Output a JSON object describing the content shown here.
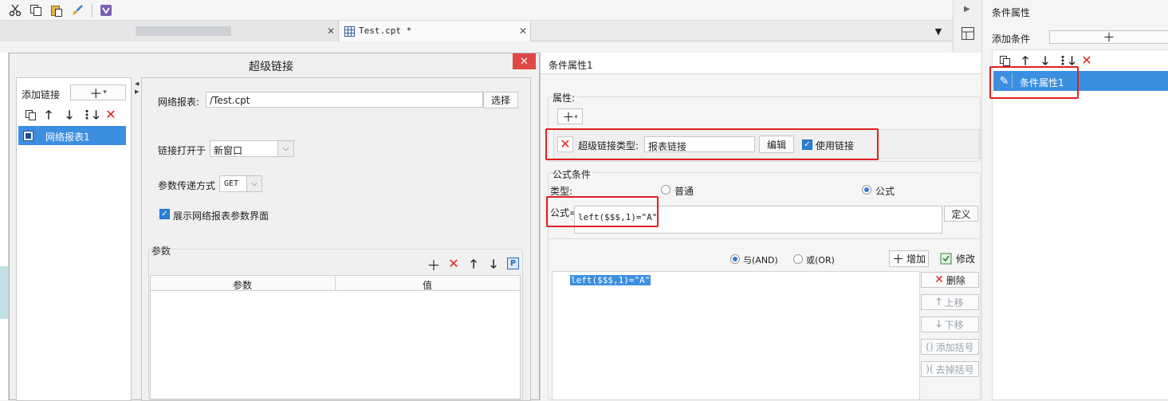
{
  "editor": {
    "tab_title": "Test.cpt *"
  },
  "hyperlink_dialog": {
    "title": "超级链接",
    "add_link_label": "添加链接",
    "link_item": "网络报表1",
    "network_report_label": "网络报表:",
    "network_report_value": "/Test.cpt",
    "select_button": "选择",
    "open_in_label": "链接打开于",
    "open_in_value": "新窗口",
    "param_method_label": "参数传递方式",
    "param_method_value": "GET",
    "show_params_label": "展示网络报表参数界面",
    "params_section": "参数",
    "params_columns": [
      "参数",
      "值"
    ]
  },
  "condition_panel": {
    "title": "条件属性1",
    "attributes_section": "属性:",
    "hyperlink_type_label": "超级链接类型:",
    "hyperlink_type_value": "报表链接",
    "edit_button": "编辑",
    "use_link_label": "使用链接",
    "formula_section": "公式条件",
    "type_label": "类型:",
    "radio_normal": "普通",
    "radio_formula": "公式",
    "formula_label": "公式=",
    "formula_value": "left($$$,1)=\"A\"",
    "define_button": "定义",
    "radio_and": "与(AND)",
    "radio_or": "或(OR)",
    "add_button": "增加",
    "modify_button": "修改",
    "condition_item": "left($$$,1)=\"A\"",
    "delete_button": "删除",
    "up_button": "上移",
    "down_button": "下移",
    "add_bracket_button": "添加括号",
    "remove_bracket_button": "去掉括号"
  },
  "right_panel": {
    "title": "条件属性",
    "add_condition_label": "添加条件",
    "item": "条件属性1"
  },
  "colors": {
    "selection": "#3c8fe0",
    "highlight": "#e02020",
    "delete": "#e0221c",
    "close": "#e04646"
  }
}
